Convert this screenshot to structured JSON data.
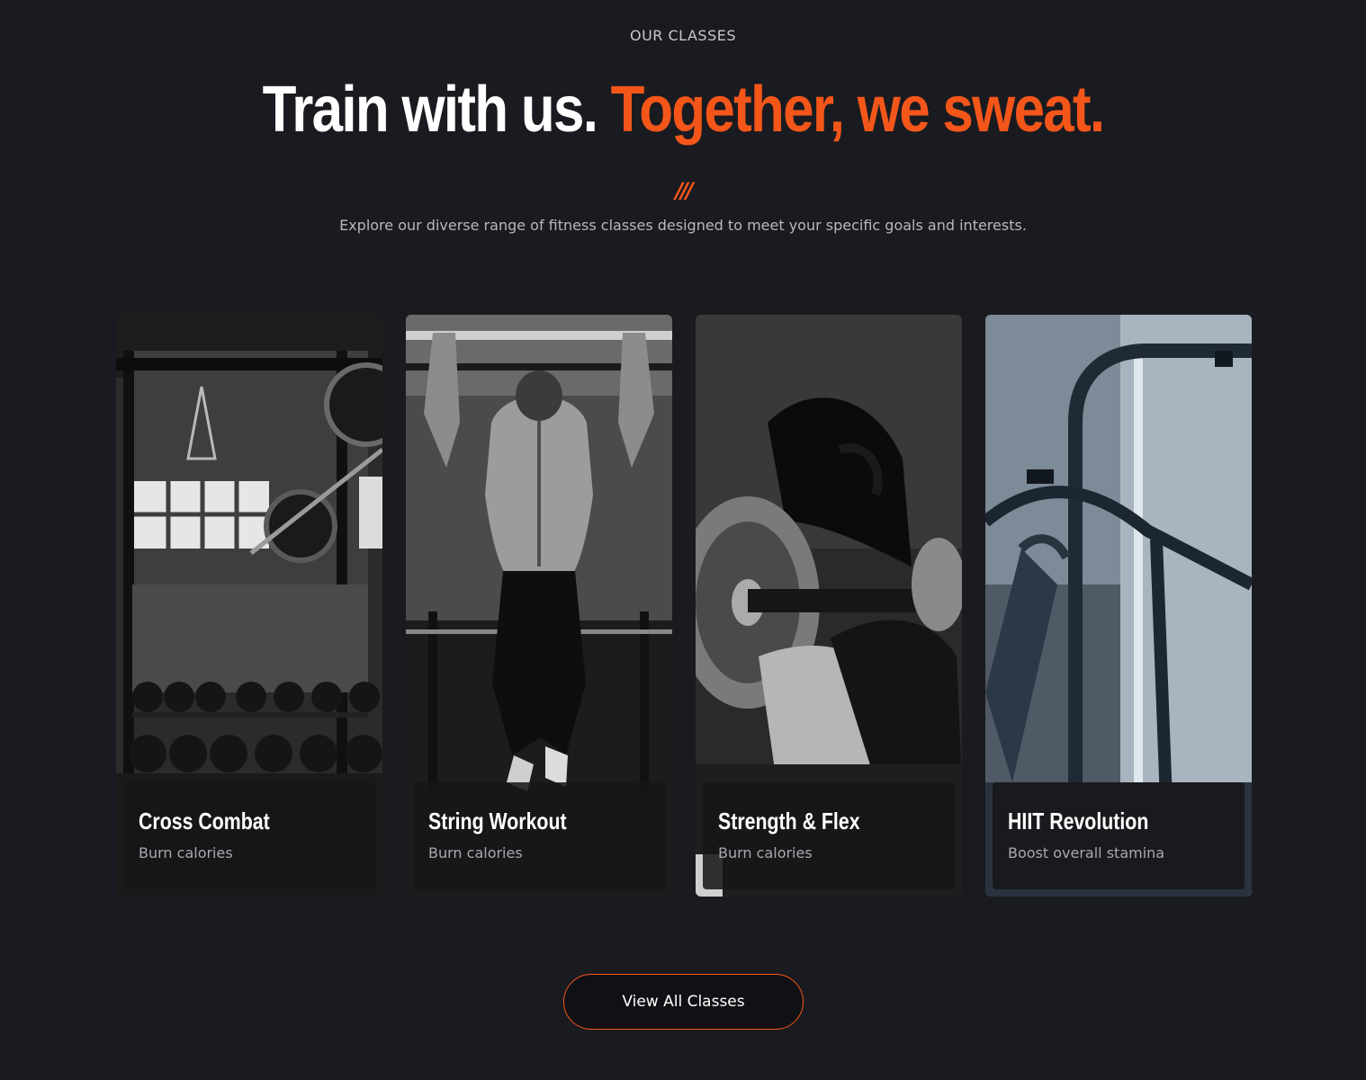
{
  "section": {
    "eyebrow": "OUR CLASSES",
    "headline_white": "Train with us.",
    "headline_accent": "Together, we sweat.",
    "decor": "///",
    "intro": "Explore our diverse range of fitness classes designed to meet your specific goals and interests."
  },
  "cards": [
    {
      "title": "Cross Combat",
      "subtitle": "Burn calories",
      "image": "gym-rack-photo"
    },
    {
      "title": "String Workout",
      "subtitle": "Burn calories",
      "image": "pull-up-photo"
    },
    {
      "title": "Strength & Flex",
      "subtitle": "Burn calories",
      "image": "barbell-woman-photo"
    },
    {
      "title": "HIIT Revolution",
      "subtitle": "Boost overall stamina",
      "image": "treadmill-photo"
    }
  ],
  "cta": {
    "label": "View All Classes"
  },
  "colors": {
    "accent": "#f4561a",
    "background": "#1a1b20"
  }
}
